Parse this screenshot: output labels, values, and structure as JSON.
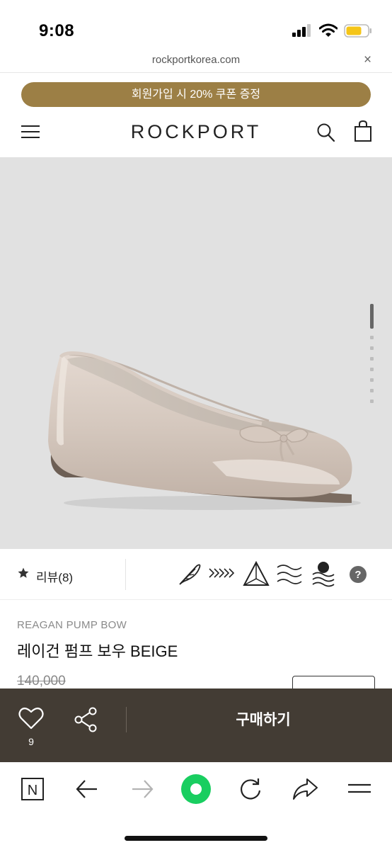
{
  "status_bar": {
    "time": "9:08",
    "icons": [
      "cellular-signal-icon",
      "wifi-icon",
      "battery-icon"
    ],
    "battery_color": "#f5c518"
  },
  "browser": {
    "url": "rockportkorea.com",
    "close_glyph": "×"
  },
  "promo_banner": {
    "text": "회원가입 시 20% 쿠폰 증정",
    "color": "#9c7f45"
  },
  "header": {
    "brand": "ROCKPORT",
    "icons": [
      "menu-icon",
      "search-icon",
      "shopping-bag-icon"
    ]
  },
  "gallery": {
    "image": "beige patent ballet flat with bow",
    "slides_total": 8,
    "active_slide": 1,
    "background": "#e1e1e1"
  },
  "reviews": {
    "label": "리뷰(8)",
    "feature_icons": [
      "feather-icon",
      "chevron-arrows-icon",
      "pyramid-icon",
      "waves-icon",
      "water-resistant-icon",
      "help-icon"
    ],
    "help_glyph": "?"
  },
  "product": {
    "subtitle": "REAGAN PUMP BOW",
    "title": "레이건 펌프 보우 BEIGE",
    "original_price": "140,000"
  },
  "action_bar": {
    "wishlist_count": "9",
    "buy_label": "구매하기",
    "background": "#433c34"
  },
  "browser_toolbar": {
    "icons": [
      "naver-n-icon",
      "back-arrow-icon",
      "forward-arrow-icon",
      "green-dot-icon",
      "refresh-icon",
      "share-arrow-icon",
      "menu-lines-icon"
    ],
    "n_glyph": "N",
    "accent": "#19ce60"
  }
}
